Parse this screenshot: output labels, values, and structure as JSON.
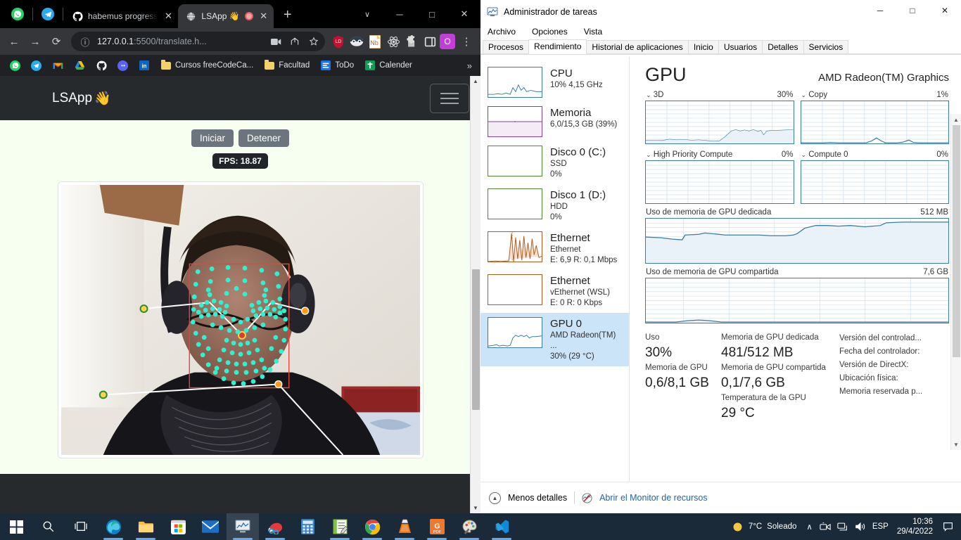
{
  "browser": {
    "pinned_tabs": [
      {
        "name": "whatsapp-pinned-tab",
        "icon": "whatsapp-icon"
      },
      {
        "name": "telegram-pinned-tab",
        "icon": "telegram-icon"
      }
    ],
    "tabs": [
      {
        "title": "habemus progress",
        "icon": "github-icon",
        "active": false,
        "close": "✕"
      },
      {
        "title": "LSApp 👋",
        "icon": "globe-icon",
        "active": true,
        "close": "✕",
        "recording": true
      }
    ],
    "new_tab_label": "+",
    "window_controls": {
      "tab_search": "∨",
      "minimize": "─",
      "maximize": "□",
      "close": "✕"
    },
    "toolbar": {
      "back": "←",
      "forward": "→",
      "reload": "⟳",
      "site_info": "ⓘ",
      "url_host": "127.0.0.1",
      "url_path": ":5500/translate.h...",
      "cast_icon": "video-camera-icon",
      "share_icon": "share-icon",
      "bookmark_icon": "star-icon",
      "profile_initial": "O",
      "menu": "⋮",
      "extensions": [
        {
          "name": "lastpass-extension",
          "label": "LD"
        },
        {
          "name": "dark-reader-extension",
          "label": ""
        },
        {
          "name": "notebook-extension",
          "label": "Nb"
        },
        {
          "name": "react-devtools-extension",
          "label": ""
        },
        {
          "name": "extensions-puzzle-icon",
          "label": ""
        },
        {
          "name": "side-panel-icon",
          "label": ""
        }
      ]
    },
    "bookmarks": [
      {
        "label": "",
        "icon": "whatsapp-icon"
      },
      {
        "label": "",
        "icon": "telegram-icon"
      },
      {
        "label": "",
        "icon": "gmail-icon"
      },
      {
        "label": "",
        "icon": "google-drive-icon"
      },
      {
        "label": "",
        "icon": "github-icon"
      },
      {
        "label": "",
        "icon": "discord-icon"
      },
      {
        "label": "",
        "icon": "linkedin-icon"
      },
      {
        "label": "Cursos freeCodeCa...",
        "icon": "folder-icon"
      },
      {
        "label": "Facultad",
        "icon": "folder-icon"
      },
      {
        "label": "ToDo",
        "icon": "google-keep-icon"
      },
      {
        "label": "Calender",
        "icon": "calendar-icon"
      }
    ],
    "bookmarks_overflow": "»"
  },
  "page": {
    "brand": "LSApp",
    "brand_emoji": "👋",
    "start_button": "Iniciar",
    "stop_button": "Detener",
    "fps_label": "FPS: 18.87"
  },
  "taskmgr": {
    "window_title": "Administrador de tareas",
    "window_controls": {
      "minimize": "─",
      "maximize": "□",
      "close": "✕"
    },
    "menu": [
      "Archivo",
      "Opciones",
      "Vista"
    ],
    "tabs": [
      {
        "label": "Procesos",
        "active": false
      },
      {
        "label": "Rendimiento",
        "active": true
      },
      {
        "label": "Historial de aplicaciones",
        "active": false
      },
      {
        "label": "Inicio",
        "active": false
      },
      {
        "label": "Usuarios",
        "active": false
      },
      {
        "label": "Detalles",
        "active": false
      },
      {
        "label": "Servicios",
        "active": false
      }
    ],
    "resources": [
      {
        "name": "cpu",
        "title": "CPU",
        "line2": "10% 4,15 GHz",
        "line3": "",
        "color": "#3a7ca5",
        "selected": false
      },
      {
        "name": "memoria",
        "title": "Memoria",
        "line2": "6,0/15,3 GB (39%)",
        "line3": "",
        "color": "#8a3fa0",
        "selected": false
      },
      {
        "name": "disco-0",
        "title": "Disco 0 (C:)",
        "line2": "SSD",
        "line3": "0%",
        "color": "#4d8b31",
        "selected": false
      },
      {
        "name": "disco-1",
        "title": "Disco 1 (D:)",
        "line2": "HDD",
        "line3": "0%",
        "color": "#4d8b31",
        "selected": false
      },
      {
        "name": "ethernet",
        "title": "Ethernet",
        "line2": "Ethernet",
        "line3": "E: 6,9 R: 0,1 Mbps",
        "color": "#b05a1e",
        "selected": false
      },
      {
        "name": "vethernet-wsl",
        "title": "Ethernet",
        "line2": "vEthernet (WSL)",
        "line3": "E: 0 R: 0 Kbps",
        "color": "#b05a1e",
        "selected": false
      },
      {
        "name": "gpu-0",
        "title": "GPU 0",
        "line2": "AMD Radeon(TM) ...",
        "line3": "30%  (29 °C)",
        "color": "#3a7ca5",
        "selected": true
      }
    ],
    "gpu": {
      "heading": "GPU",
      "model": "AMD Radeon(TM) Graphics",
      "engines": [
        {
          "name": "3d",
          "label": "3D",
          "value": "30%"
        },
        {
          "name": "copy",
          "label": "Copy",
          "value": "1%"
        },
        {
          "name": "high-priority-compute",
          "label": "High Priority Compute",
          "value": "0%"
        },
        {
          "name": "compute-0",
          "label": "Compute 0",
          "value": "0%"
        }
      ],
      "memory_graphs": [
        {
          "name": "dedicated-memory-graph",
          "label": "Uso de memoria de GPU dedicada",
          "max": "512 MB"
        },
        {
          "name": "shared-memory-graph",
          "label": "Uso de memoria de GPU compartida",
          "max": "7,6 GB"
        }
      ],
      "stats_col1": [
        {
          "label": "Uso",
          "value": "30%"
        },
        {
          "label": "Memoria de GPU",
          "value": "0,6/8,1 GB"
        }
      ],
      "stats_col2": [
        {
          "label": "Memoria de GPU dedicada",
          "value": "481/512 MB"
        },
        {
          "label": "Memoria de GPU compartida",
          "value": "0,1/7,6 GB"
        },
        {
          "label": "Temperatura de la GPU",
          "value": "29 °C"
        }
      ],
      "stats_col3": [
        "Versión del controlad...",
        "Fecha del controlador:",
        "Versión de DirectX:",
        "Ubicación física:",
        "Memoria reservada p..."
      ]
    },
    "footer": {
      "fewer_details": "Menos detalles",
      "resource_monitor": "Abrir el Monitor de recursos"
    }
  },
  "taskbar": {
    "items": [
      {
        "name": "start-button",
        "icon": "windows-icon"
      },
      {
        "name": "search-button",
        "icon": "search-icon"
      },
      {
        "name": "task-view-button",
        "icon": "task-view-icon"
      },
      {
        "name": "edge-taskbar-icon",
        "icon": "edge-icon"
      },
      {
        "name": "file-explorer-taskbar-icon",
        "icon": "folder-icon"
      },
      {
        "name": "microsoft-store-taskbar-icon",
        "icon": "store-icon"
      },
      {
        "name": "mail-taskbar-icon",
        "icon": "mail-icon"
      },
      {
        "name": "task-manager-taskbar-icon",
        "icon": "task-manager-icon"
      },
      {
        "name": "snipping-tool-taskbar-icon",
        "icon": "snipping-tool-icon"
      },
      {
        "name": "calculator-taskbar-icon",
        "icon": "calculator-icon"
      },
      {
        "name": "notepad-taskbar-icon",
        "icon": "notepad-icon"
      },
      {
        "name": "chrome-taskbar-icon",
        "icon": "chrome-icon"
      },
      {
        "name": "vlc-taskbar-icon",
        "icon": "vlc-icon"
      },
      {
        "name": "pdf-taskbar-icon",
        "icon": "pdf-icon"
      },
      {
        "name": "paint-taskbar-icon",
        "icon": "paint-icon"
      },
      {
        "name": "vscode-taskbar-icon",
        "icon": "vscode-icon"
      }
    ],
    "weather": {
      "temp": "7°C",
      "desc": "Soleado"
    },
    "tray": {
      "chevron": "∧",
      "language": "ESP"
    },
    "clock": {
      "time": "10:36",
      "date": "29/4/2022"
    }
  },
  "colors": {
    "accent_blue": "#3a7ca5",
    "taskbar_bg": "#1b2a38",
    "page_bg": "#f6fff0",
    "navbar_bg": "#262a2d"
  }
}
